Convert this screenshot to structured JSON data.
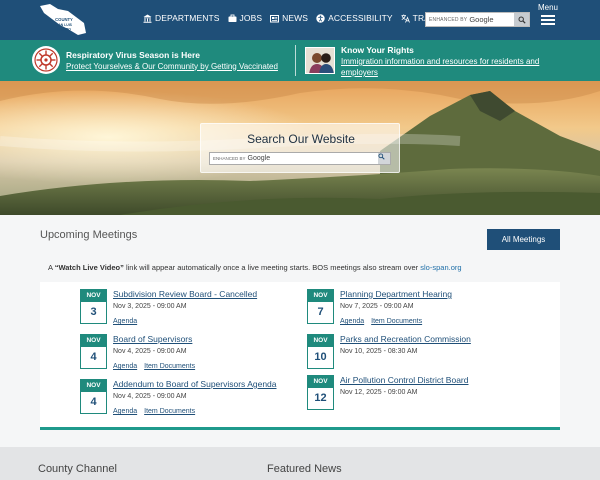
{
  "header": {
    "logo_text": "COUNTY OF SAN LUIS OBISPO",
    "nav": [
      {
        "label": "DEPARTMENTS",
        "icon": "building-icon"
      },
      {
        "label": "JOBS",
        "icon": "briefcase-icon"
      },
      {
        "label": "NEWS",
        "icon": "newspaper-icon"
      },
      {
        "label": "ACCESSIBILITY",
        "icon": "accessibility-icon"
      },
      {
        "label": "TRANSLATE",
        "icon": "translate-icon"
      }
    ],
    "search": {
      "brand": "ENHANCED BY",
      "engine": "Google"
    },
    "menu_label": "Menu"
  },
  "alert": {
    "title": "Respiratory Virus Season is Here",
    "link": "Protect Yourselves & Our Community by Getting Vaccinated",
    "rights_title": "Know Your Rights",
    "rights_link": "Immigration information and resources for residents and employers"
  },
  "hero": {
    "title": "Search Our Website",
    "search": {
      "brand": "ENHANCED BY",
      "engine": "Google"
    }
  },
  "meetings": {
    "title": "Upcoming Meetings",
    "all_button": "All Meetings",
    "notice_prefix": "A ",
    "notice_bold": "“Watch Live Video”",
    "notice_middle": " link will appear automatically once a live meeting starts. BOS meetings also stream over ",
    "notice_link": "slo-span.org",
    "events": [
      {
        "month": "NOV",
        "day": "3",
        "title": "Subdivision Review Board - Cancelled",
        "datetime": "Nov  3, 2025 - 09:00 AM",
        "links": [
          "Agenda"
        ]
      },
      {
        "month": "NOV",
        "day": "4",
        "title": "Board of Supervisors",
        "datetime": "Nov  4, 2025 - 09:00 AM",
        "links": [
          "Agenda",
          "Item Documents"
        ]
      },
      {
        "month": "NOV",
        "day": "4",
        "title": "Addendum to Board of Supervisors Agenda",
        "datetime": "Nov  4, 2025 - 09:00 AM",
        "links": [
          "Agenda",
          "Item Documents"
        ]
      },
      {
        "month": "NOV",
        "day": "7",
        "title": "Planning Department Hearing",
        "datetime": "Nov  7, 2025 - 09:00 AM",
        "links": [
          "Agenda",
          "Item Documents"
        ]
      },
      {
        "month": "NOV",
        "day": "10",
        "title": "Parks and Recreation Commission",
        "datetime": "Nov 10, 2025 - 08:30 AM",
        "links": []
      },
      {
        "month": "NOV",
        "day": "12",
        "title": "Air Pollution Control District Board",
        "datetime": "Nov 12, 2025 - 09:00 AM",
        "links": []
      }
    ]
  },
  "bottom": {
    "left": "County Channel",
    "right": "Featured News"
  },
  "colors": {
    "navy": "#1f4f78",
    "teal": "#1f8a7d"
  }
}
